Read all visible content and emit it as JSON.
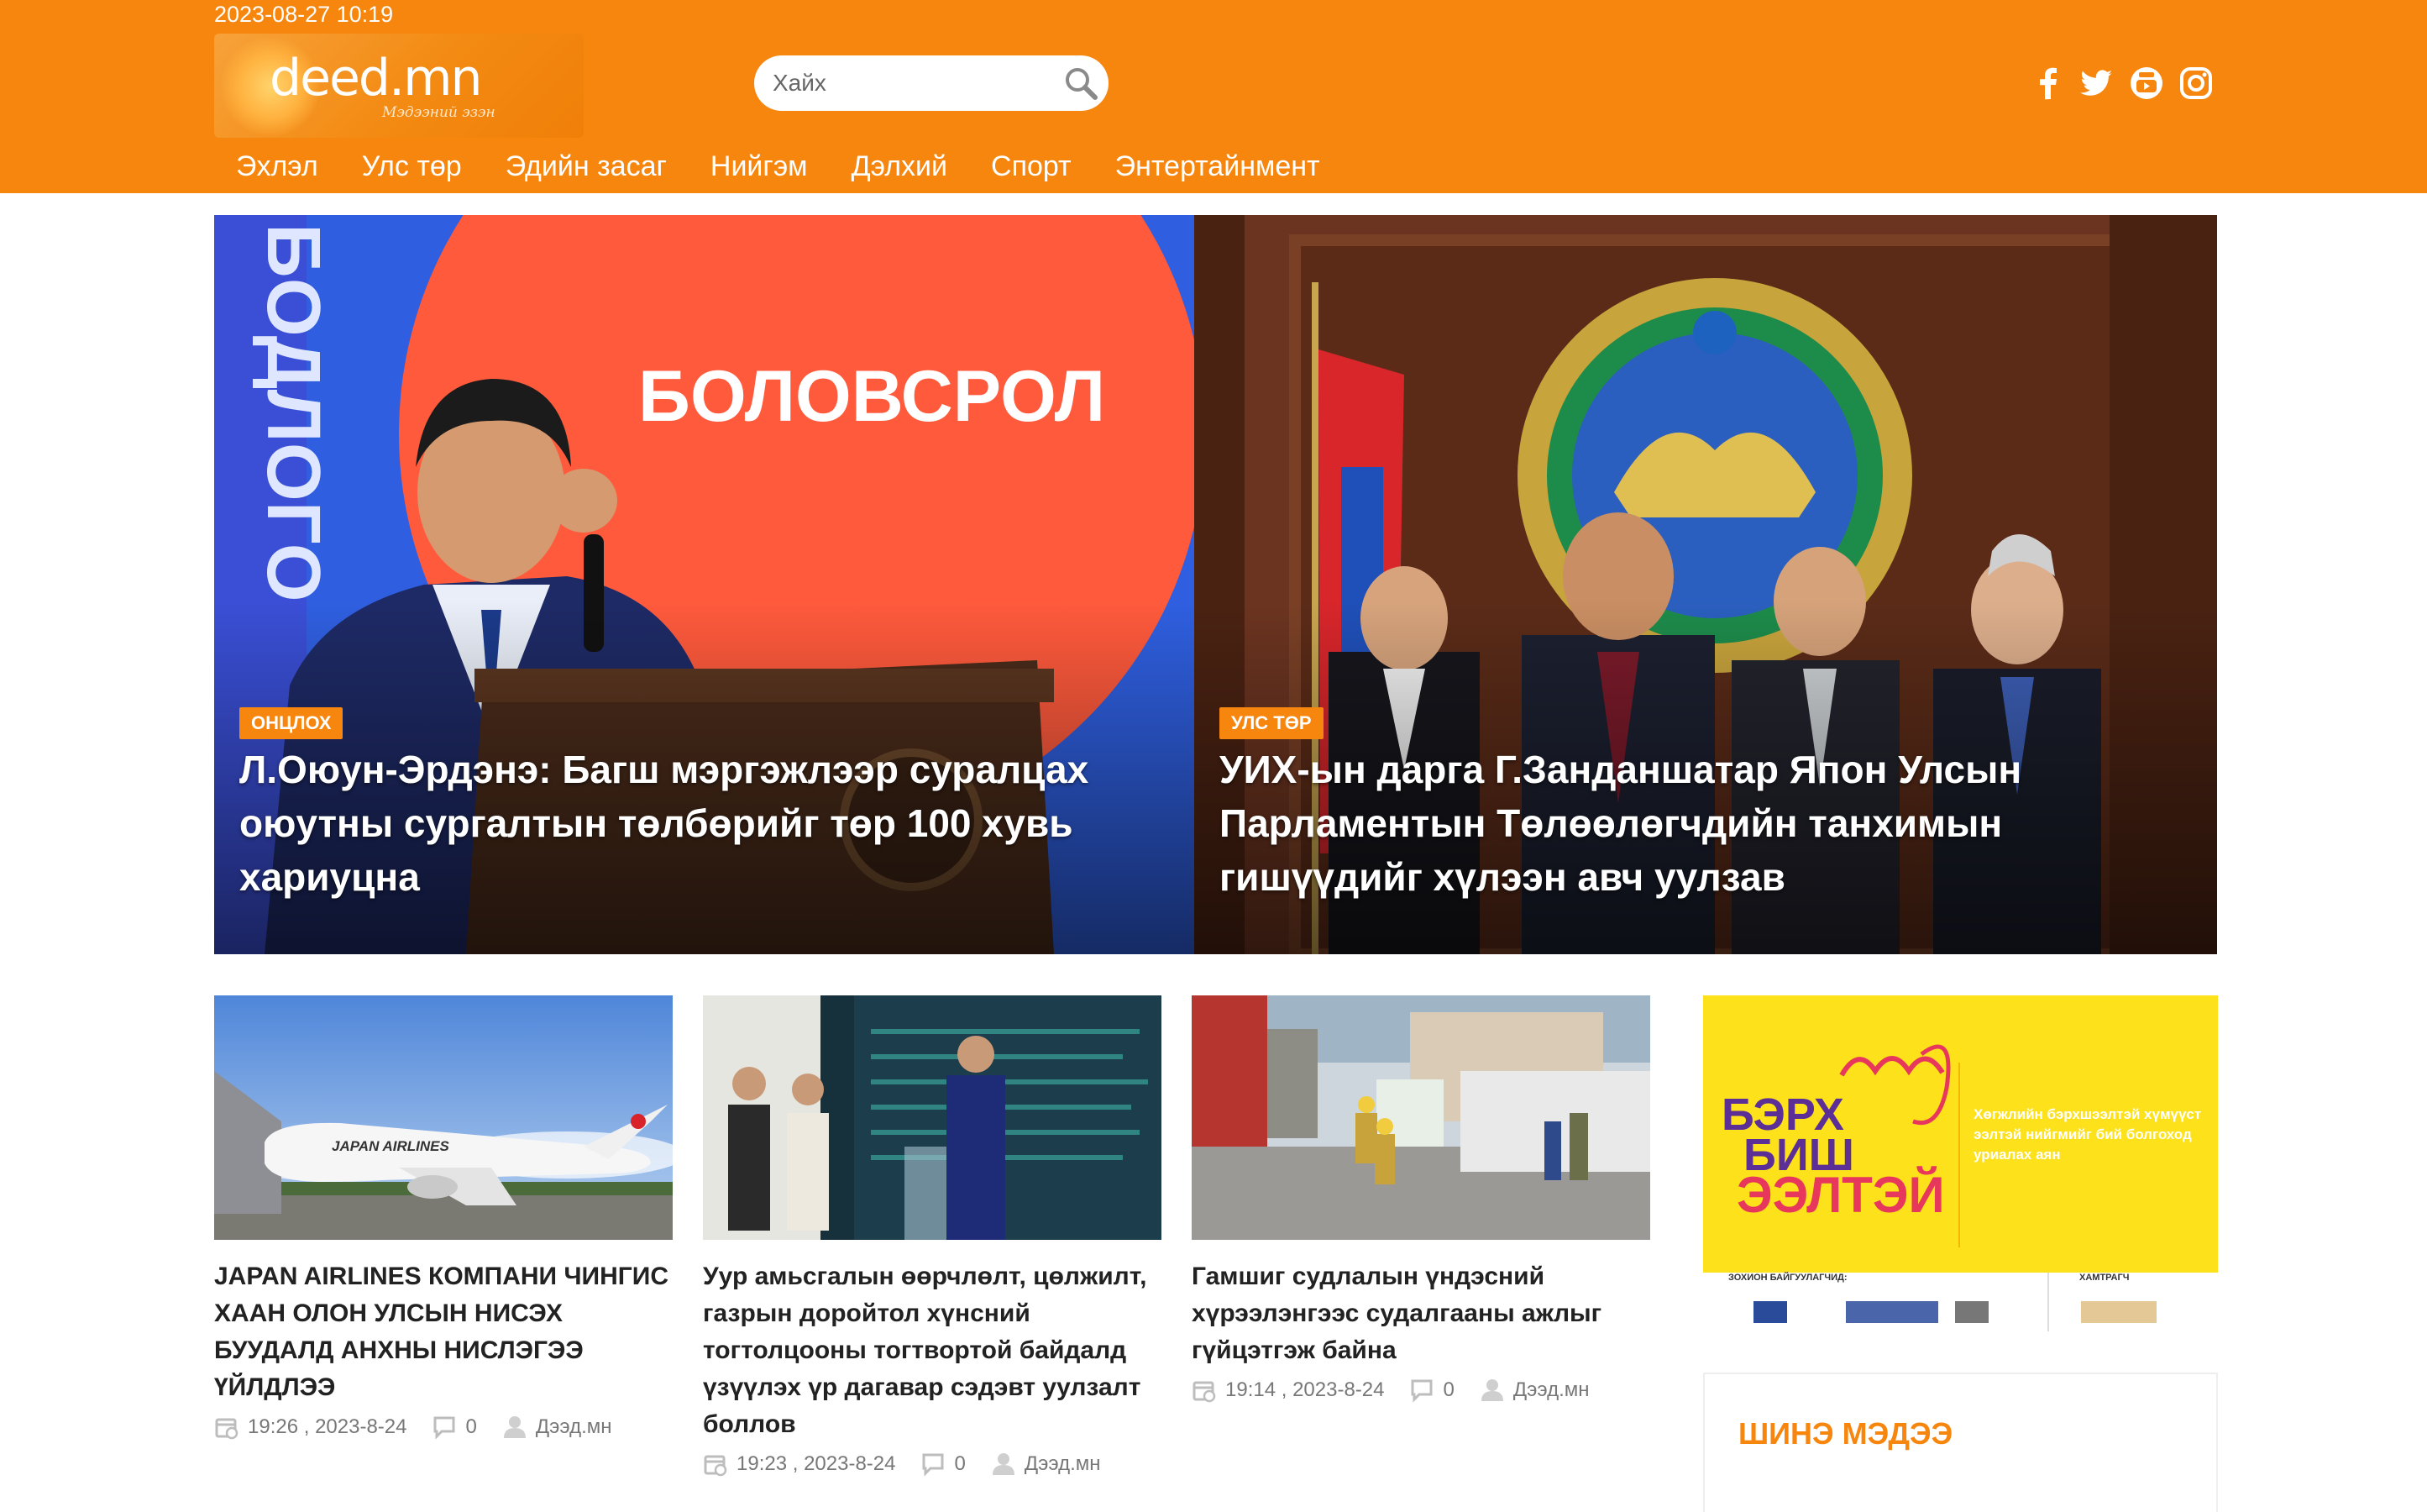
{
  "header": {
    "datetime": "2023-08-27 10:19",
    "logo_text": "deed.mn",
    "logo_sub": "Мэдээний эзэн",
    "search_placeholder": "Хайх",
    "social": [
      "facebook-icon",
      "twitter-icon",
      "youtube-icon",
      "instagram-icon"
    ],
    "colors": {
      "brand": "#f7860f",
      "text": "#ffffff"
    }
  },
  "nav": {
    "items": [
      "Эхлэл",
      "Улс төр",
      "Эдийн засаг",
      "Нийгэм",
      "Дэлхий",
      "Спорт",
      "Энтертайнмент"
    ]
  },
  "hero": [
    {
      "tag": "ОНЦЛОХ",
      "title": "Л.Оюун-Эрдэнэ: Багш мэргэжлээр суралцах оюутны сургалтын төлбөрийг төр 100 хувь хариуцна",
      "image_text_1": "БОЛОВСРОЛ",
      "image_text_2": "БОДЛОГО"
    },
    {
      "tag": "УЛС ТӨР",
      "title": "УИХ-ын дарга Г.Занданшатар Япон Улсын Парламентын Төлөөлөгчдийн танхимын гишүүдийг хүлээн авч уулзав"
    }
  ],
  "cards": [
    {
      "title": "JAPAN AIRLINES КОМПАНИ ЧИНГИС ХААН ОЛОН УЛСЫН НИСЭХ БУУДАЛД АНХНЫ НИСЛЭГЭЭ ҮЙЛДЛЭЭ",
      "time": "19:26 , 2023-8-24",
      "comments": "0",
      "author": "Дээд.мн",
      "image_text": "JAPAN AIRLINES"
    },
    {
      "title": "Уур амьсгалын өөрчлөлт, цөлжилт, газрын доройтол хүнсний тогтолцооны тогтвортой байдалд үзүүлэх үр дагавар сэдэвт уулзалт боллов",
      "time": "19:23 , 2023-8-24",
      "comments": "0",
      "author": "Дээд.мн"
    },
    {
      "title": "Гамшиг судлалын үндэсний хүрээлэнгээс судалгааны ажлыг гүйцэтгэж байна",
      "time": "19:14 , 2023-8-24",
      "comments": "0",
      "author": "Дээд.мн"
    }
  ],
  "sidebar": {
    "ad_line_1": "БЭРХ",
    "ad_line_2": "БИШ",
    "ad_line_3": "ЭЭЛТЭЙ",
    "ad_slogan": "Хөгжлийн бэрхшээлтэй хүмүүст ээлтэй нийгмийг бий болгоход уриалах аян",
    "ad_org_label": "ЗОХИОН БАЙГУУЛАГЧИД:",
    "ad_partner_label": "ХАМТРАГЧ",
    "latest_title": "ШИНЭ МЭДЭЭ"
  }
}
